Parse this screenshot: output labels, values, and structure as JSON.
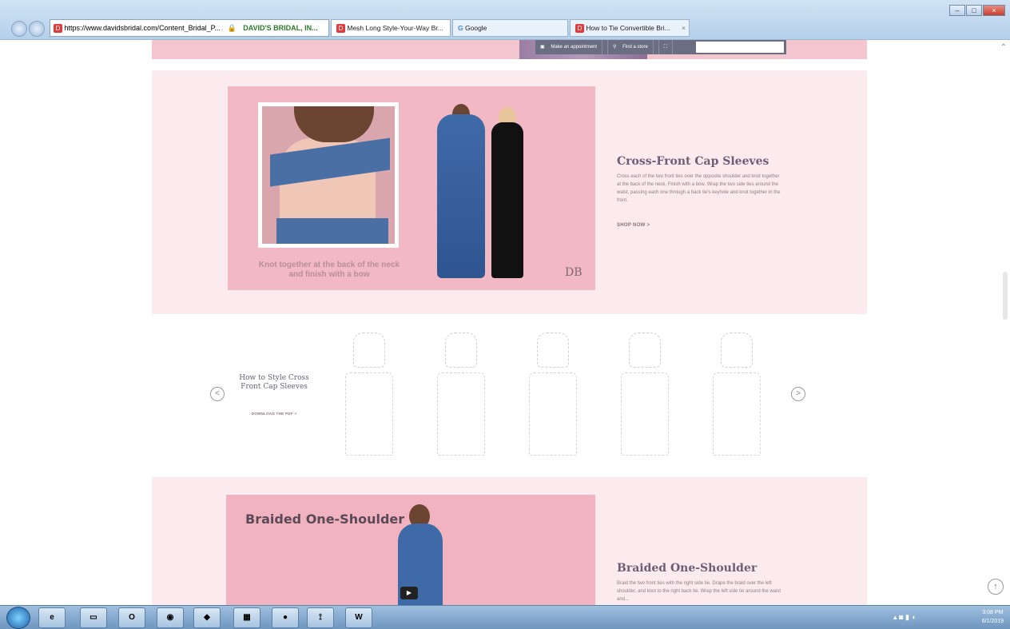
{
  "browser": {
    "address": "https://www.davidsbridal.com/Content_Bridal_P...",
    "cert": "DAVID'S BRIDAL, IN...",
    "tabs": [
      {
        "label": "Mesh Long Style-Your-Way Br..."
      },
      {
        "label": "Google"
      },
      {
        "label": "How to Tie Convertible Bri..."
      }
    ]
  },
  "site_bar": {
    "appointment": "Make an appointment",
    "find_store": "Find a store",
    "search_placeholder": ""
  },
  "section1": {
    "caption": "Knot together at the back of the neck and finish with a bow",
    "logo": "DB",
    "title": "Cross-Front Cap Sleeves",
    "body": "Cross each of the two front ties over the opposite shoulder and knot together at the back of the neck. Finish with a bow. Wrap the two side ties around the waist, passing each one through a back tie's keyhole and knot together in the front.",
    "shop": "SHOP NOW >"
  },
  "carousel": {
    "title": "How to Style Cross Front Cap Sleeves",
    "download": "DOWNLOAD THE PDF >",
    "prev": "<",
    "next": ">"
  },
  "section2": {
    "label": "Braided One-Shoulder",
    "title": "Braided One-Shoulder",
    "body": "Braid the two front ties with the right side tie. Drape the braid over the left shoulder, and knot to the right back tie. Wrap the left side tie around the waist and..."
  },
  "taskbar": {
    "items": [
      "",
      "",
      "",
      "",
      "",
      "",
      "",
      "",
      "",
      "W"
    ],
    "clock_time": "3:08 PM",
    "clock_date": "6/1/2019"
  },
  "colors": {
    "pink_bg": "#fbeaee",
    "photo_pink": "#f2b8c3",
    "dress_blue": "#3f6aa8",
    "title": "#6d5e74"
  }
}
